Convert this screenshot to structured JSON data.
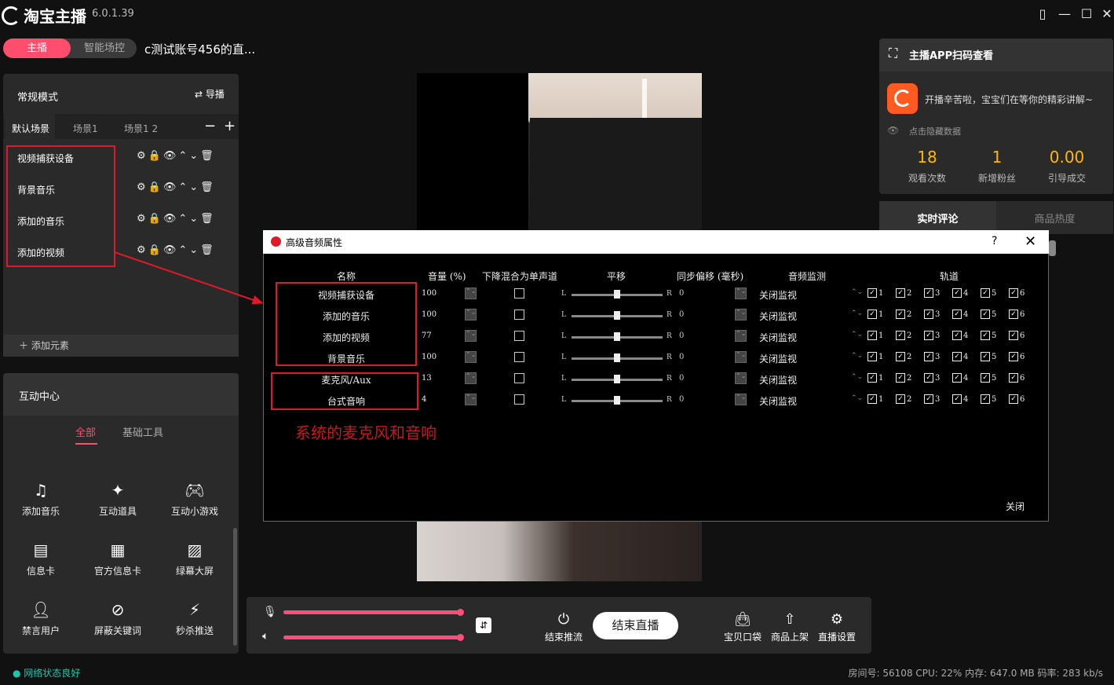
{
  "app": {
    "name": "淘宝主播",
    "version": "6.0.1.39"
  },
  "mode_tabs": {
    "active": "主播",
    "inactive": "智能场控"
  },
  "account_title": "c测试账号456的直...",
  "scene_panel": {
    "title": "常规模式",
    "guide": "导播",
    "tabs": [
      "默认场景",
      "场景1",
      "场景1 2"
    ],
    "sources": [
      "视频捕获设备",
      "背景音乐",
      "添加的音乐",
      "添加的视频"
    ],
    "add_element": "添加元素"
  },
  "interaction": {
    "title": "互动中心",
    "tabs": [
      "全部",
      "基础工具"
    ],
    "tools": [
      {
        "label": "添加音乐",
        "icon": "music-icon"
      },
      {
        "label": "互动道具",
        "icon": "props-icon"
      },
      {
        "label": "互动小游戏",
        "icon": "gamepad-icon"
      },
      {
        "label": "信息卡",
        "icon": "info-card-icon"
      },
      {
        "label": "官方信息卡",
        "icon": "official-card-icon"
      },
      {
        "label": "绿幕大屏",
        "icon": "green-screen-icon"
      },
      {
        "label": "禁言用户",
        "icon": "mute-user-icon"
      },
      {
        "label": "屏蔽关键词",
        "icon": "block-keyword-icon"
      },
      {
        "label": "秒杀推送",
        "icon": "flash-sale-icon"
      }
    ]
  },
  "bottom_bar": {
    "end_push": "结束推流",
    "end_live": "结束直播",
    "buttons": [
      "宝贝口袋",
      "商品上架",
      "直播设置"
    ],
    "mic_level": 1.0,
    "speaker_level": 1.0
  },
  "right_panel": {
    "scan_title": "主播APP扫码查看",
    "greeting": "开播辛苦啦，宝宝们在等你的精彩讲解~",
    "hide_data": "点击隐藏数据",
    "stats": [
      {
        "value": "18",
        "label": "观看次数"
      },
      {
        "value": "1",
        "label": "新增粉丝"
      },
      {
        "value": "0.00",
        "label": "引导成交"
      }
    ],
    "tabs": [
      "实时评论",
      "商品热度"
    ]
  },
  "status": {
    "network": "网络状态良好",
    "sysinfo": "房间号: 56108  CPU: 22%  内存: 647.0 MB  码率: 283 kb/s"
  },
  "dialog": {
    "title": "高级音频属性",
    "help": "?",
    "close_label": "关闭",
    "headers": {
      "name": "名称",
      "volume": "音量 (%)",
      "downmix": "下降混合为单声道",
      "pan": "平移",
      "sync": "同步偏移 (毫秒)",
      "monitor": "音频监测",
      "tracks": "轨道"
    },
    "rows": [
      {
        "name": "视频捕获设备",
        "volume": "100",
        "sync": "0",
        "monitor": "关闭监视"
      },
      {
        "name": "添加的音乐",
        "volume": "100",
        "sync": "0",
        "monitor": "关闭监视"
      },
      {
        "name": "添加的视频",
        "volume": "77",
        "sync": "0",
        "monitor": "关闭监视"
      },
      {
        "name": "背景音乐",
        "volume": "100",
        "sync": "0",
        "monitor": "关闭监视"
      },
      {
        "name": "麦克风/Aux",
        "volume": "13",
        "sync": "0",
        "monitor": "关闭监视"
      },
      {
        "name": "台式音响",
        "volume": "4",
        "sync": "0",
        "monitor": "关闭监视"
      }
    ],
    "track_numbers": [
      "1",
      "2",
      "3",
      "4",
      "5",
      "6"
    ],
    "pan_l": "L",
    "pan_r": "R",
    "annotation": "系统的麦克风和音响"
  }
}
